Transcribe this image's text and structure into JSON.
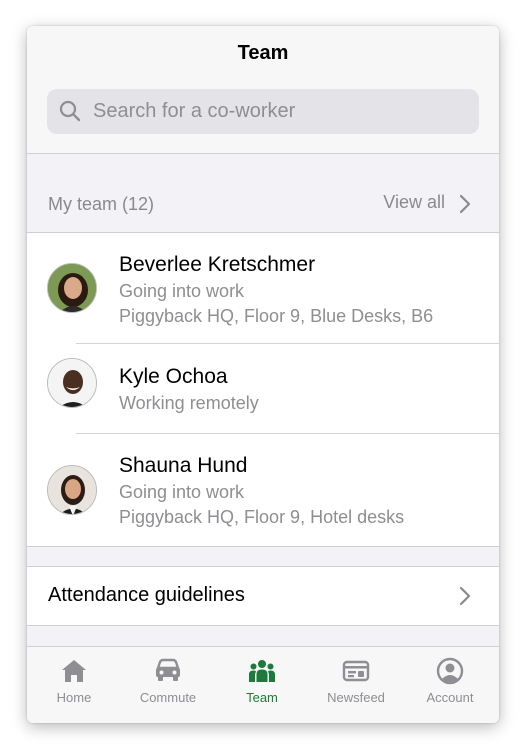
{
  "nav": {
    "title": "Team"
  },
  "search": {
    "placeholder": "Search for a co-worker"
  },
  "my_team": {
    "title": "My team (12)",
    "view_all_label": "View all"
  },
  "members": [
    {
      "name": "Beverlee Kretschmer",
      "status": "Going into work",
      "location": "Piggyback HQ, Floor 9, Blue Desks, B6"
    },
    {
      "name": "Kyle Ochoa",
      "status": "Working remotely",
      "location": ""
    },
    {
      "name": "Shauna Hund",
      "status": "Going into work",
      "location": "Piggyback HQ, Floor 9, Hotel desks"
    }
  ],
  "guidelines": {
    "label": "Attendance guidelines"
  },
  "tabs": [
    {
      "label": "Home",
      "icon": "house-icon"
    },
    {
      "label": "Commute",
      "icon": "car-icon"
    },
    {
      "label": "Team",
      "icon": "people-icon",
      "active": true
    },
    {
      "label": "Newsfeed",
      "icon": "newspaper-icon"
    },
    {
      "label": "Account",
      "icon": "account-icon"
    }
  ],
  "colors": {
    "accent": "#1e7a3c",
    "inactive": "#8e8e93",
    "secondary_text": "#8e8e93"
  }
}
